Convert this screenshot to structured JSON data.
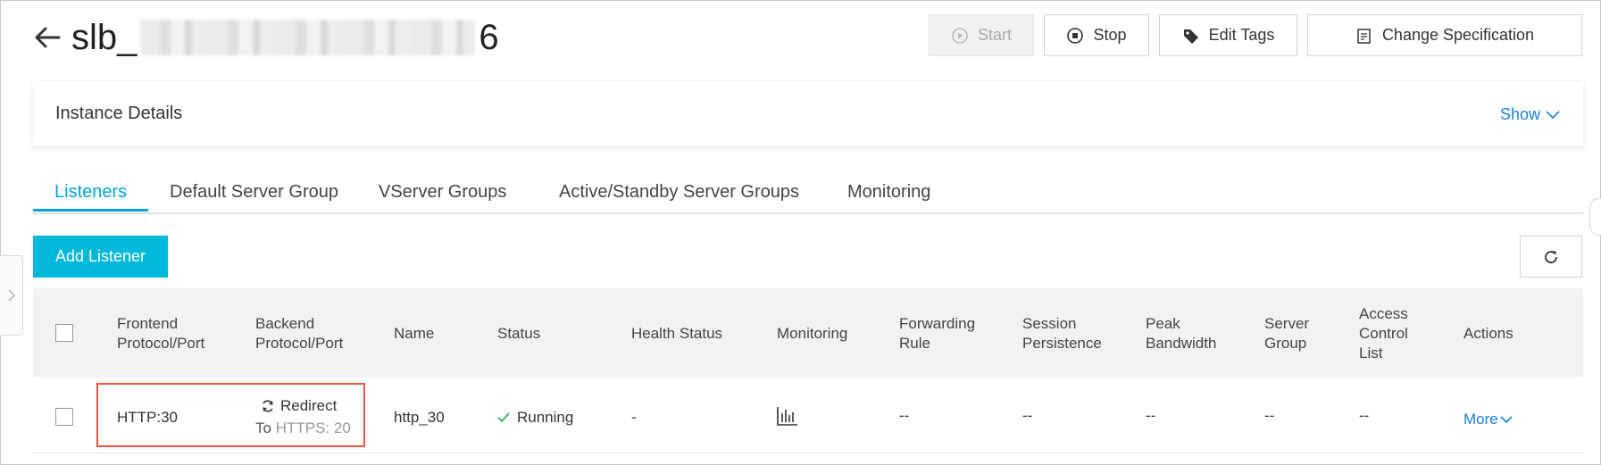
{
  "header": {
    "title_prefix": "slb_",
    "title_suffix": "6",
    "buttons": {
      "start": "Start",
      "stop": "Stop",
      "edit_tags": "Edit Tags",
      "change_spec": "Change Specification"
    }
  },
  "details": {
    "label": "Instance Details",
    "toggle": "Show"
  },
  "tabs": [
    "Listeners",
    "Default Server Group",
    "VServer Groups",
    "Active/Standby Server Groups",
    "Monitoring"
  ],
  "toolbar": {
    "add_listener": "Add Listener"
  },
  "table": {
    "headers": {
      "frontend": [
        "Frontend",
        "Protocol/Port"
      ],
      "backend": [
        "Backend",
        "Protocol/Port"
      ],
      "name": "Name",
      "status": "Status",
      "health": "Health Status",
      "monitoring": "Monitoring",
      "forwarding": [
        "Forwarding",
        "Rule"
      ],
      "session": [
        "Session",
        "Persistence"
      ],
      "bandwidth": [
        "Peak",
        "Bandwidth"
      ],
      "server_group": [
        "Server",
        "Group"
      ],
      "acl": [
        "Access",
        "Control",
        "List"
      ],
      "actions": "Actions"
    },
    "rows": [
      {
        "frontend": "HTTP:30",
        "backend_line1": "Redirect",
        "backend_to": "To",
        "backend_target": "HTTPS: 20",
        "name": "http_30",
        "status": "Running",
        "health": "-",
        "forwarding": "--",
        "session": "--",
        "bandwidth": "--",
        "server_group": "--",
        "acl": "--",
        "actions": "More"
      }
    ]
  },
  "colors": {
    "accent": "#00a3d9",
    "button_primary": "#00b8d9",
    "link": "#1b7fe0",
    "highlight": "#e8573d",
    "running": "#2fb36b"
  }
}
